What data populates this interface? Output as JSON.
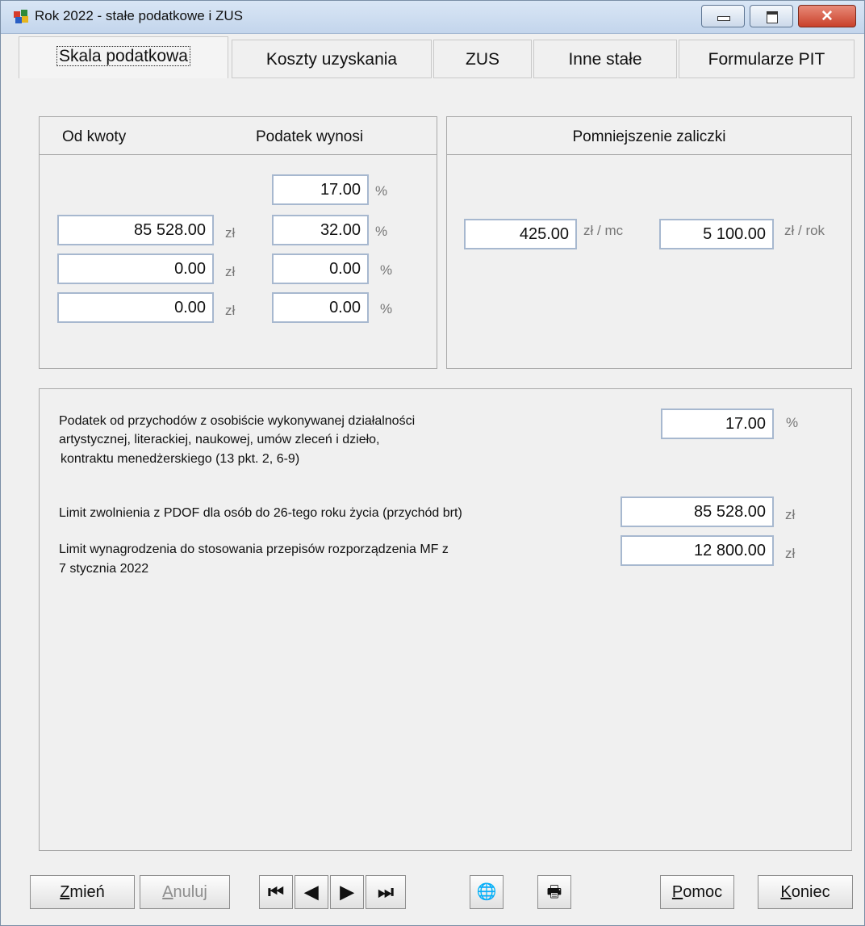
{
  "window": {
    "title": "Rok 2022 - stałe podatkowe i ZUS",
    "close_glyph": "✕"
  },
  "tabs": [
    {
      "label": "Skala podatkowa",
      "active": true
    },
    {
      "label": "Koszty uzyskania",
      "active": false
    },
    {
      "label": "ZUS",
      "active": false
    },
    {
      "label": "Inne stałe",
      "active": false
    },
    {
      "label": "Formularze PIT",
      "active": false
    }
  ],
  "scale": {
    "header_from": "Od kwoty",
    "header_tax": "Podatek wynosi",
    "rates": [
      "17.00",
      "32.00",
      "0.00",
      "0.00"
    ],
    "thresholds": [
      "85 528.00",
      "0.00",
      "0.00"
    ],
    "currency_unit": "zł",
    "percent_unit": "%"
  },
  "reduction": {
    "header": "Pomniejszenie zaliczki",
    "monthly_value": "425.00",
    "monthly_unit": "zł / mc",
    "yearly_value": "5 100.00",
    "yearly_unit": "zł / rok"
  },
  "other": {
    "artistic_label_1": "Podatek od przychodów z osobiście wykonywanej działalności",
    "artistic_label_2": "artystycznej, literackiej, naukowej, umów zleceń i dzieło,",
    "artistic_label_3": "kontraktu menedżerskiego (13 pkt. 2, 6-9)",
    "artistic_value": "17.00",
    "artistic_unit": "%",
    "youth_label": "Limit zwolnienia z PDOF dla osób do 26-tego roku życia (przychód brt)",
    "youth_value": "85 528.00",
    "youth_unit": "zł",
    "mf_label_1": "Limit wynagrodzenia do stosowania przepisów rozporządzenia MF z",
    "mf_label_2": "7 stycznia 2022",
    "mf_value": "12 800.00",
    "mf_unit": "zł"
  },
  "toolbar": {
    "edit_label": "Zmień",
    "edit_mnemonic": "Z",
    "cancel_label": "Anuluj",
    "cancel_mnemonic": "A",
    "first_glyph": "⏮",
    "prev_glyph": "◀",
    "next_glyph": "▶",
    "last_glyph": "⏭",
    "globe_glyph": "🌐",
    "print_glyph": "🖶",
    "help_label": "Pomoc",
    "help_mnemonic": "P",
    "exit_label": "Koniec",
    "exit_mnemonic": "K"
  }
}
